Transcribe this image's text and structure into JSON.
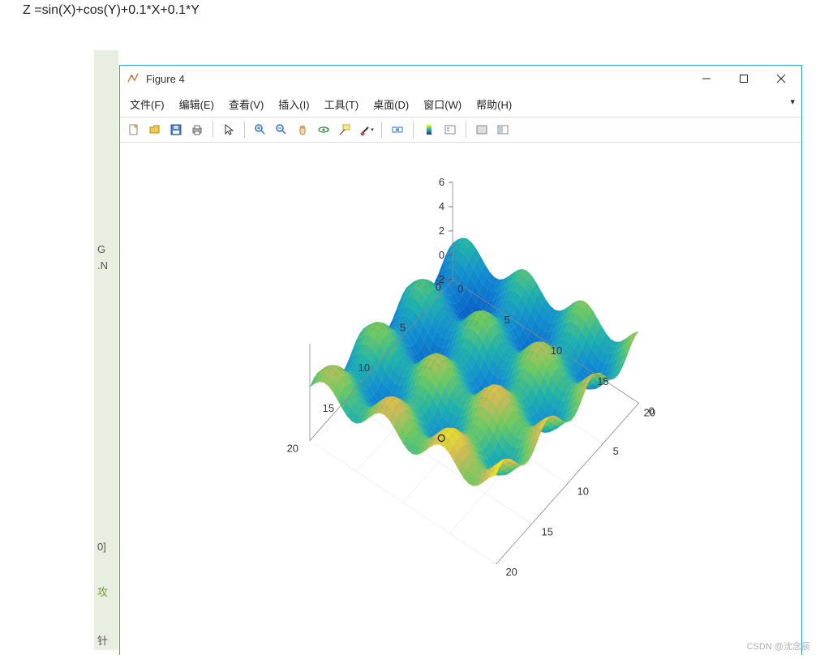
{
  "formula": "Z =sin(X)+cos(Y)+0.1*X+0.1*Y",
  "window": {
    "title": "Figure 4",
    "controls": {
      "minimize": "—",
      "maximize": "□",
      "close": "×"
    }
  },
  "menu": {
    "file": "文件(F)",
    "edit": "编辑(E)",
    "view": "查看(V)",
    "insert": "插入(I)",
    "tool": "工具(T)",
    "desktop": "桌面(D)",
    "window": "窗口(W)",
    "help": "帮助(H)"
  },
  "toolbar_icons": {
    "new": "new-file-icon",
    "open": "open-folder-icon",
    "save": "save-icon",
    "print": "print-icon",
    "pointer": "pointer-icon",
    "zoomin": "zoom-in-icon",
    "zoomout": "zoom-out-icon",
    "pan": "pan-hand-icon",
    "rotate3d": "rotate-3d-icon",
    "datacursor": "data-cursor-icon",
    "brush": "brush-icon",
    "link": "link-icon",
    "colorbar": "colorbar-icon",
    "legend": "legend-icon",
    "hide": "hide-tools-icon",
    "dock": "dock-icon"
  },
  "background_strings": {
    "g": "G",
    "n": ".N",
    "zero": "0]",
    "x": "攻",
    "li": "针"
  },
  "watermark": "CSDN @沈念辰",
  "chart_data": {
    "type": "surface",
    "function": "Z = sin(X) + cos(Y) + 0.1*X + 0.1*Y",
    "x_range": [
      0,
      20
    ],
    "y_range": [
      0,
      20
    ],
    "z_range": [
      -2,
      6
    ],
    "x_ticks": [
      0,
      5,
      10,
      15,
      20
    ],
    "y_ticks": [
      0,
      5,
      10,
      15,
      20
    ],
    "z_ticks": [
      -2,
      0,
      2,
      4,
      6
    ],
    "x_step": 0.2,
    "y_step": 0.2,
    "colormap": "parula",
    "colormap_stops": [
      {
        "t": 0.0,
        "color": "#352a87"
      },
      {
        "t": 0.15,
        "color": "#0864c9"
      },
      {
        "t": 0.35,
        "color": "#108ed2"
      },
      {
        "t": 0.5,
        "color": "#1fb2ab"
      },
      {
        "t": 0.65,
        "color": "#6dc960"
      },
      {
        "t": 0.8,
        "color": "#d1ba56"
      },
      {
        "t": 1.0,
        "color": "#f9fb0e"
      }
    ],
    "view": {
      "azimuth": -37.5,
      "elevation": 30
    },
    "peak_marker": {
      "x": 14.14,
      "y": 20.0,
      "z": 5.41,
      "symbol": "o"
    }
  }
}
